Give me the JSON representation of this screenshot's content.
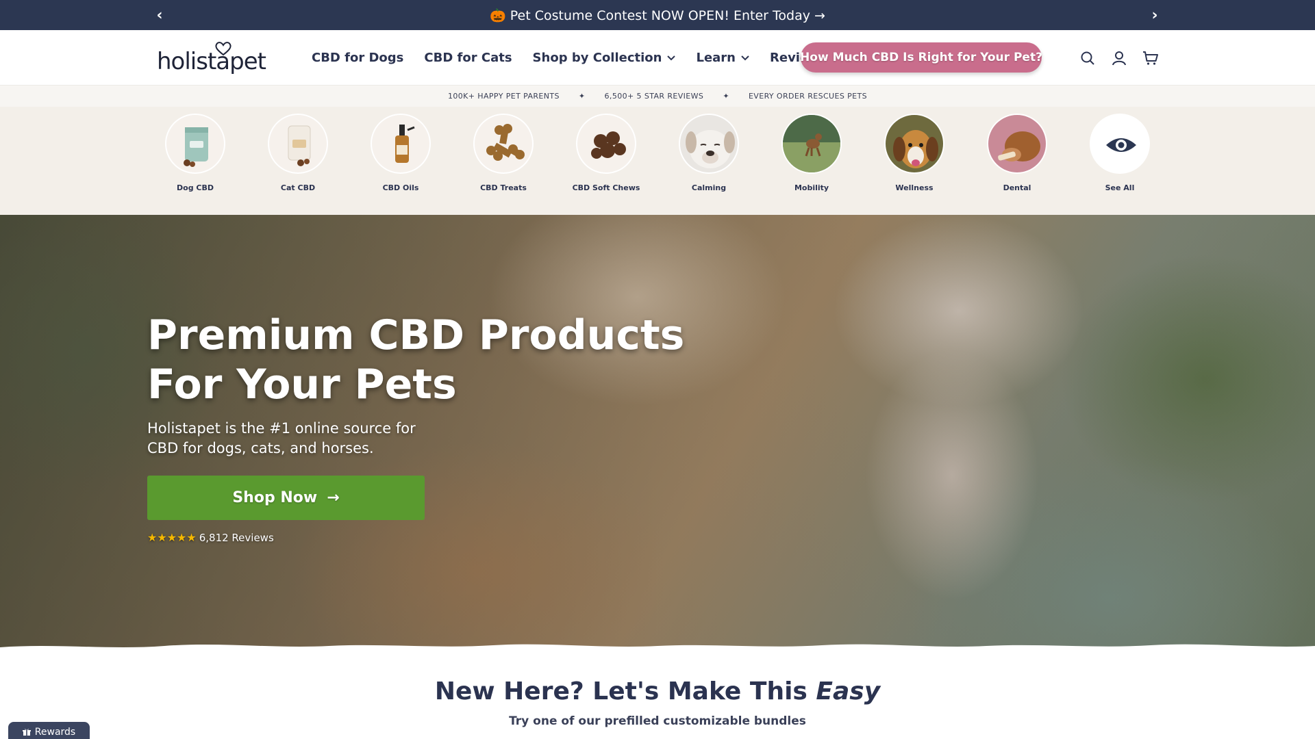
{
  "announcement": {
    "prev_label": "‹",
    "next_label": "›",
    "message": "🎃 Pet Costume Contest NOW OPEN! Enter Today →"
  },
  "header": {
    "logo_text": "holistapet",
    "nav": [
      {
        "label": "CBD for Dogs",
        "dropdown": false
      },
      {
        "label": "CBD for Cats",
        "dropdown": false
      },
      {
        "label": "Shop by Collection",
        "dropdown": true
      },
      {
        "label": "Learn",
        "dropdown": true
      },
      {
        "label": "Reviews",
        "dropdown": false
      }
    ],
    "cta_label": "How Much CBD Is Right for Your Pet?",
    "icons": [
      "search-icon",
      "account-icon",
      "cart-icon"
    ]
  },
  "trust": {
    "items": [
      "100K+ HAPPY PET PARENTS",
      "6,500+ 5 STAR REVIEWS",
      "EVERY ORDER RESCUES PETS"
    ],
    "separator": "✦"
  },
  "categories": [
    {
      "label": "Dog CBD"
    },
    {
      "label": "Cat CBD"
    },
    {
      "label": "CBD Oils"
    },
    {
      "label": "CBD Treats"
    },
    {
      "label": "CBD Soft Chews"
    },
    {
      "label": "Calming"
    },
    {
      "label": "Mobility"
    },
    {
      "label": "Wellness"
    },
    {
      "label": "Dental"
    },
    {
      "label": "See All"
    }
  ],
  "hero": {
    "title_line1": "Premium CBD Products",
    "title_line2": "For Your Pets",
    "subtitle": "Holistapet is the #1 online source for CBD for dogs, cats, and horses.",
    "button_label": "Shop Now",
    "button_arrow": "→",
    "stars": "★★★★★",
    "reviews_label": "6,812 Reviews"
  },
  "intro": {
    "title_main": "New Here? Let's Make This ",
    "title_emphasis": "Easy",
    "subtitle": "Try one of our prefilled customizable bundles"
  },
  "rewards": {
    "label": "Rewards"
  },
  "colors": {
    "navy": "#2c3752",
    "pink_cta": "#c96d8c",
    "green_button": "#5a9a2f",
    "cream_strip": "#f3efe9",
    "star": "#f5b800"
  }
}
